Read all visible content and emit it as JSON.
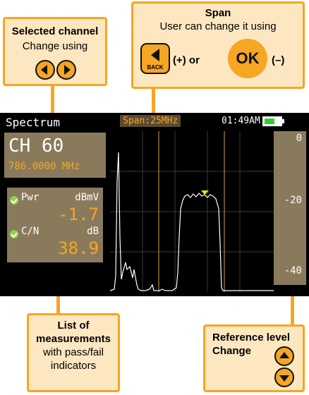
{
  "callouts": {
    "selected_channel": {
      "title": "Selected channel",
      "sub": "Change using"
    },
    "span": {
      "title": "Span",
      "sub": "User can change it using",
      "plus": "(+) or",
      "ok": "OK",
      "minus": "(–)",
      "back": "BACK"
    },
    "measurements": {
      "title1": "List of",
      "title2": "measurements",
      "sub1": "with pass/fail",
      "sub2": "indicators"
    },
    "reference": {
      "title1": "Reference level",
      "title2": "Change"
    }
  },
  "screen": {
    "title": "Spectrum",
    "span_label": "Span:25MHz",
    "time": "01:49AM",
    "channel": "CH 60",
    "frequency": "786.0000 MHz",
    "measurements": [
      {
        "name": "Pwr",
        "unit": "dBmV",
        "value": "-1.7",
        "status": "pass"
      },
      {
        "name": "C/N",
        "unit": "dB",
        "value": "38.9",
        "status": "pass"
      }
    ],
    "scale": [
      "0",
      "-20",
      "-40"
    ]
  },
  "colors": {
    "accent": "#f5a623",
    "callout_bg": "#fde7c1",
    "panel": "#8a7a5c",
    "pass": "#8fd14f"
  }
}
